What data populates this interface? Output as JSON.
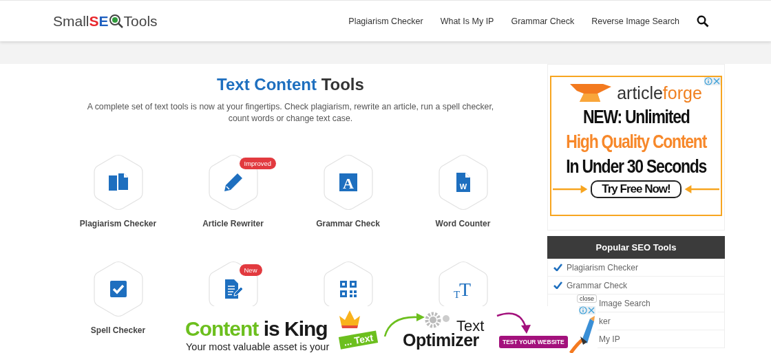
{
  "header": {
    "logo": {
      "start": "Small",
      "accent": "SE",
      "end": "Tools"
    },
    "nav": [
      {
        "label": "Plagiarism Checker"
      },
      {
        "label": "What Is My IP"
      },
      {
        "label": "Grammar Check"
      },
      {
        "label": "Reverse Image Search"
      }
    ]
  },
  "main": {
    "title_highlight": "Text Content",
    "title_rest": "Tools",
    "description": "A complete set of text tools is now at your fingertips. Check plagiarism, rewrite an article, run a spell checker, count words or change text case.",
    "tools": [
      {
        "label": "Plagiarism Checker",
        "kind": "copy"
      },
      {
        "label": "Article Rewriter",
        "kind": "pencil",
        "badge": "Improved"
      },
      {
        "label": "Grammar Check",
        "kind": "letter",
        "glyph": "A"
      },
      {
        "label": "Word Counter",
        "kind": "doc",
        "glyph": "W"
      },
      {
        "label": "Spell Checker",
        "kind": "check"
      },
      {
        "kind": "docedit",
        "badge": "New"
      },
      {
        "kind": "qr"
      },
      {
        "kind": "textsize",
        "glyph": "TT"
      }
    ]
  },
  "sidebar": {
    "ad": {
      "brand_start": "article",
      "brand_end": "forge",
      "line_1": "NEW: Unlimited",
      "line_2": "High Quality Content",
      "line_3": "In Under 30 Seconds",
      "button": "Try Free Now!"
    },
    "popular": {
      "title": "Popular SEO Tools",
      "items": [
        {
          "label": "Plagiarism Checker",
          "kind": "tick"
        },
        {
          "label": "Grammar Check",
          "kind": "tick"
        },
        {
          "label": "Image Search",
          "kind": "covered"
        },
        {
          "label": "ker",
          "kind": "covered"
        },
        {
          "label": "My IP",
          "kind": "covered"
        }
      ]
    }
  },
  "banner": {
    "headline_green": "Content",
    "headline_dark": "is King",
    "subline": "Your most valuable asset is your",
    "tag": "... Text",
    "product_top": "Text",
    "product_bottom": "Optimizer",
    "button": "TEST YOUR WEBSITE",
    "close_tip": "close"
  }
}
